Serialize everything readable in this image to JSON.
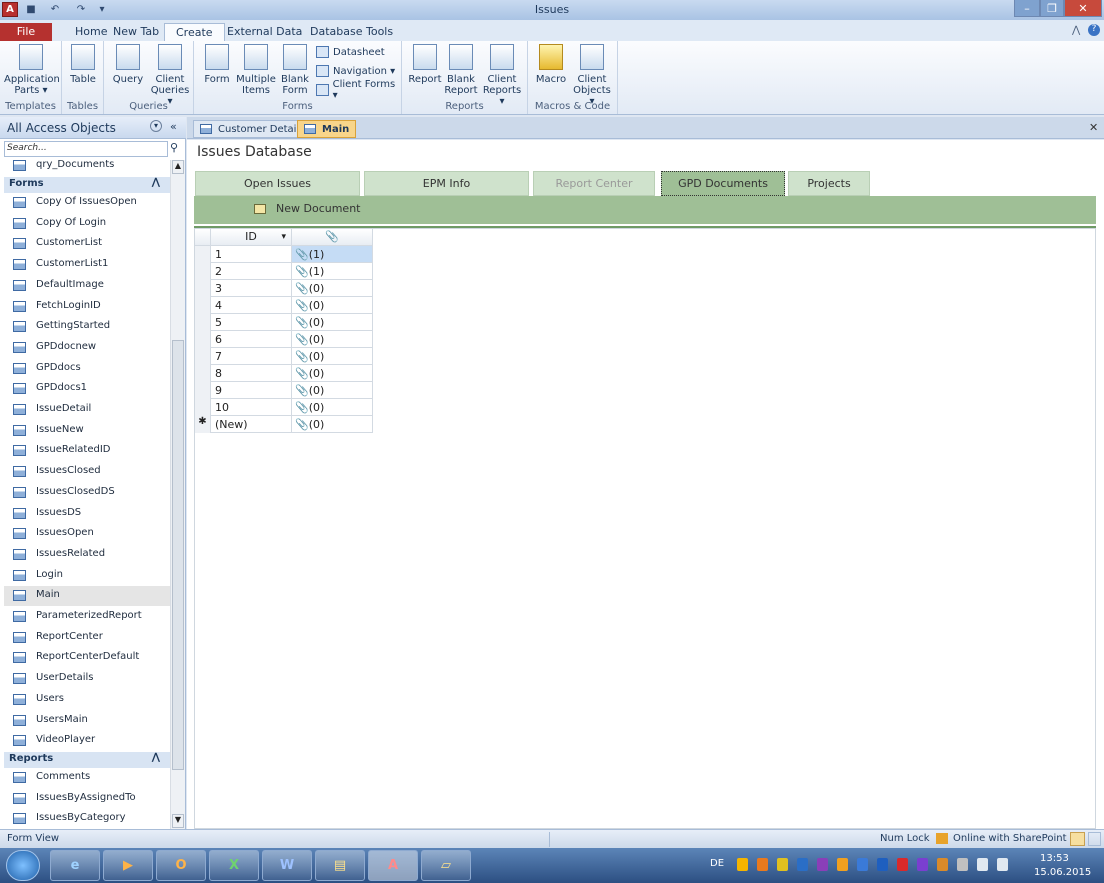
{
  "window": {
    "title": "Issues"
  },
  "ribbon_tabs": [
    "File",
    "Home",
    "New Tab",
    "Create",
    "External Data",
    "Database Tools"
  ],
  "ribbon": {
    "templates": {
      "label": "Templates",
      "app_parts": [
        "Application",
        "Parts ▾"
      ]
    },
    "tables": {
      "label": "Tables",
      "table": "Table"
    },
    "queries": {
      "label": "Queries",
      "query": "Query",
      "client_queries": [
        "Client",
        "Queries ▾"
      ]
    },
    "forms": {
      "label": "Forms",
      "form": "Form",
      "multiple_items": [
        "Multiple",
        "Items"
      ],
      "blank_form": [
        "Blank",
        "Form"
      ],
      "datasheet": "Datasheet",
      "navigation": "Navigation ▾",
      "client_forms": "Client Forms ▾"
    },
    "reports": {
      "label": "Reports",
      "report": "Report",
      "blank_report": [
        "Blank",
        "Report"
      ],
      "client_reports": [
        "Client",
        "Reports ▾"
      ]
    },
    "macros": {
      "label": "Macros & Code",
      "macro": "Macro",
      "client_objects": [
        "Client",
        "Objects ▾"
      ]
    }
  },
  "nav": {
    "title": "All Access Objects",
    "search_placeholder": "Search...",
    "top_item": "qry_Documents",
    "forms_label": "Forms",
    "forms": [
      "Copy Of IssuesOpen",
      "Copy Of Login",
      "CustomerList",
      "CustomerList1",
      "DefaultImage",
      "FetchLoginID",
      "GettingStarted",
      "GPDdocnew",
      "GPDdocs",
      "GPDdocs1",
      "IssueDetail",
      "IssueNew",
      "IssueRelatedID",
      "IssuesClosed",
      "IssuesClosedDS",
      "IssuesDS",
      "IssuesOpen",
      "IssuesRelated",
      "Login",
      "Main",
      "ParameterizedReport",
      "ReportCenter",
      "ReportCenterDefault",
      "UserDetails",
      "Users",
      "UsersMain",
      "VideoPlayer"
    ],
    "selected_form": "Main",
    "reports_label": "Reports",
    "reports": [
      "Comments",
      "IssuesByAssignedTo",
      "IssuesByCategory"
    ]
  },
  "doc_tabs": [
    "Customer Details",
    "Main"
  ],
  "form": {
    "title": "Issues Database",
    "tabs": [
      "Open Issues",
      "EPM Info",
      "Report Center",
      "GPD Documents",
      "Projects"
    ],
    "active_tab": "GPD Documents",
    "new_document": "New Document",
    "grid": {
      "col_id": "ID",
      "sort_glyph": "▾",
      "attach_glyph": "⚙",
      "rows": [
        {
          "id": "1",
          "att": "(1)"
        },
        {
          "id": "2",
          "att": "(1)"
        },
        {
          "id": "3",
          "att": "(0)"
        },
        {
          "id": "4",
          "att": "(0)"
        },
        {
          "id": "5",
          "att": "(0)"
        },
        {
          "id": "6",
          "att": "(0)"
        },
        {
          "id": "7",
          "att": "(0)"
        },
        {
          "id": "8",
          "att": "(0)"
        },
        {
          "id": "9",
          "att": "(0)"
        },
        {
          "id": "10",
          "att": "(0)"
        }
      ],
      "new_row": {
        "marker": "✱",
        "id": "(New)",
        "att": "(0)"
      }
    }
  },
  "status": {
    "left": "Form View",
    "num_lock": "Num Lock",
    "sharepoint": "Online with SharePoint"
  },
  "taskbar": {
    "lang": "DE",
    "time": "13:53",
    "date": "15.06.2015"
  }
}
